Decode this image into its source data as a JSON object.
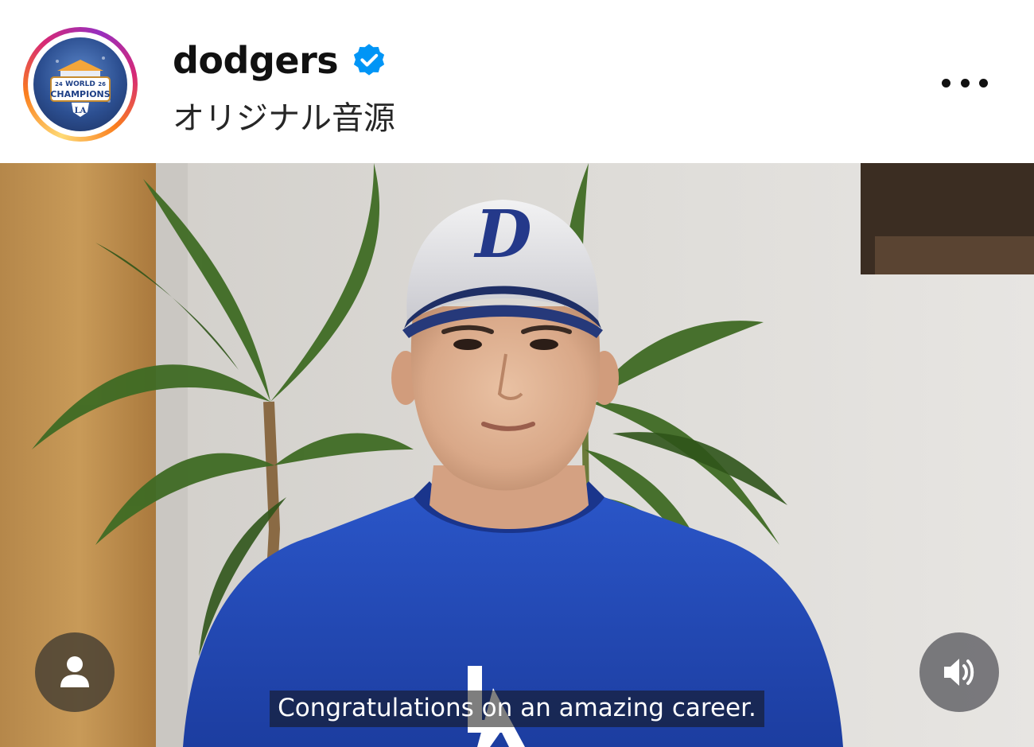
{
  "post_header": {
    "username": "dodgers",
    "verified": true,
    "audio_label": "オリジナル音源",
    "avatar": {
      "icon": "world-champions-badge",
      "badge_text_top": "WORLD",
      "badge_text_main": "CHAMPIONS",
      "badge_year_left": "24",
      "badge_year_right": "26"
    },
    "more_icon": "more-horizontal-icon"
  },
  "video": {
    "caption": "Congratulations on an amazing career.",
    "tag_users_icon": "user-icon",
    "sound_icon": "speaker-on-icon"
  },
  "colors": {
    "story_ring": [
      "#feda75",
      "#fa7e1e",
      "#d62976",
      "#962fbf"
    ],
    "verified_blue": "#0095f6",
    "dodgers_blue": "#1f3f9e"
  }
}
